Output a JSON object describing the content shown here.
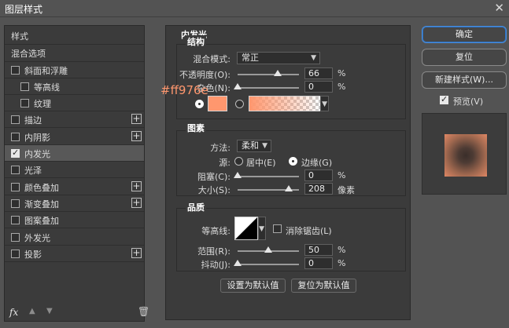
{
  "window": {
    "title": "图层样式",
    "close_glyph": "✕"
  },
  "left_panel": {
    "header_styles": "样式",
    "header_blend": "混合选项",
    "items": [
      {
        "label": "斜面和浮雕",
        "checked": false,
        "plus": false
      },
      {
        "label": "等高线",
        "checked": false,
        "plus": false
      },
      {
        "label": "纹理",
        "checked": false,
        "plus": false
      },
      {
        "label": "描边",
        "checked": false,
        "plus": true
      },
      {
        "label": "内阴影",
        "checked": false,
        "plus": true
      },
      {
        "label": "内发光",
        "checked": true,
        "plus": false
      },
      {
        "label": "光泽",
        "checked": false,
        "plus": false
      },
      {
        "label": "颜色叠加",
        "checked": false,
        "plus": true
      },
      {
        "label": "渐变叠加",
        "checked": false,
        "plus": true
      },
      {
        "label": "图案叠加",
        "checked": false,
        "plus": false
      },
      {
        "label": "外发光",
        "checked": false,
        "plus": false
      },
      {
        "label": "投影",
        "checked": false,
        "plus": true
      }
    ],
    "plus_glyph": "+",
    "fx_label": "fx",
    "up_glyph": "▲",
    "down_glyph": "▼",
    "trash_glyph": "🗑"
  },
  "inner_glow": {
    "title": "内发光",
    "structure": {
      "title": "结构",
      "blend_mode_label": "混合模式:",
      "blend_mode_value": "常正",
      "opacity_label": "不透明度(O):",
      "opacity_value": "66",
      "opacity_unit": "%",
      "opacity_fraction": 0.66,
      "noise_label": "杂色(N):",
      "noise_value": "0",
      "noise_unit": "%",
      "noise_fraction": 0.0,
      "color_hex_annotation": "#ff976e",
      "solid_color": "#ff976e",
      "gradient_color": "#ff976e"
    },
    "elements": {
      "title": "图素",
      "technique_label": "方法:",
      "technique_value": "柔和",
      "source_label": "源:",
      "center_label": "居中(E)",
      "edge_label": "边缘(G)",
      "choke_label": "阻塞(C):",
      "choke_value": "0",
      "choke_unit": "%",
      "choke_fraction": 0.0,
      "size_label": "大小(S):",
      "size_value": "208",
      "size_unit": "像素",
      "size_fraction": 0.83
    },
    "quality": {
      "title": "品质",
      "contour_label": "等高线:",
      "antialias_label": "消除锯齿(L)",
      "range_label": "范围(R):",
      "range_value": "50",
      "range_unit": "%",
      "range_fraction": 0.5,
      "jitter_label": "抖动(J):",
      "jitter_value": "0",
      "jitter_unit": "%",
      "jitter_fraction": 0.0
    },
    "make_default": "设置为默认值",
    "reset_default": "复位为默认值"
  },
  "right_panel": {
    "ok": "确定",
    "reset": "复位",
    "new_style": "新建样式(W)...",
    "preview_label": "预览(V)",
    "preview_checked": true
  }
}
